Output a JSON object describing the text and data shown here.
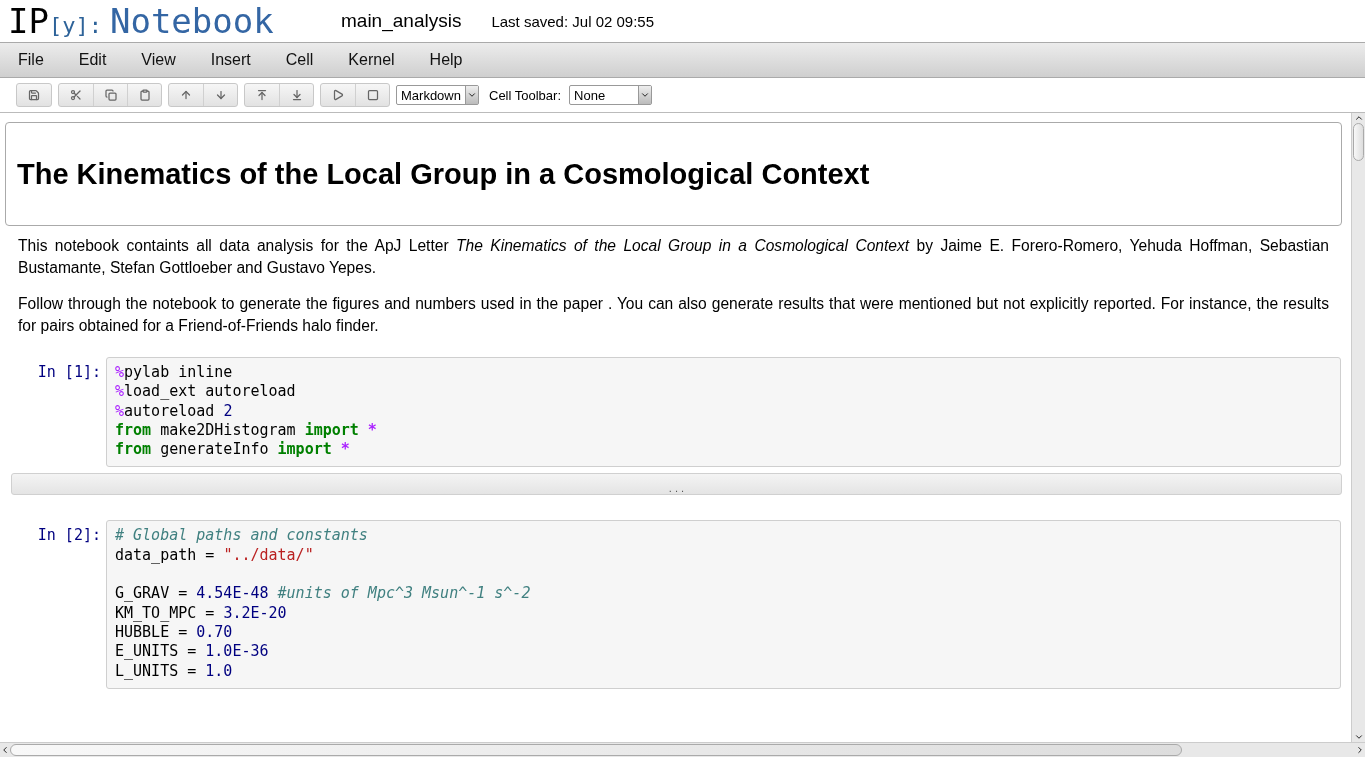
{
  "header": {
    "logo_main": "IP",
    "logo_bracket": "[y]:",
    "logo_word": "Notebook",
    "notebook_name": "main_analysis",
    "last_saved": "Last saved: Jul 02 09:55"
  },
  "menu": [
    "File",
    "Edit",
    "View",
    "Insert",
    "Cell",
    "Kernel",
    "Help"
  ],
  "toolbar": {
    "cell_type": "Markdown",
    "cell_toolbar_label": "Cell Toolbar:",
    "cell_toolbar_value": "None"
  },
  "cells": [
    {
      "kind": "heading",
      "selected": true,
      "text": "The Kinematics of the Local Group in a Cosmological Context"
    },
    {
      "kind": "markdown",
      "selected": false,
      "paragraphs": [
        "This notebook containts all data analysis for the ApJ Letter *The Kinematics of the Local Group in a Cosmological Context* by Jaime E. Forero-Romero, Yehuda Hoffman, Sebastian Bustamante, Stefan Gottloeber and Gustavo Yepes.",
        "Follow through the notebook to generate the figures and numbers used in the paper . You can also generate results that were mentioned but not explicitly reported. For instance, the results for pairs obtained for a Friend-of-Friends halo finder."
      ]
    },
    {
      "kind": "code",
      "selected": false,
      "prompt": "In [1]:",
      "lines": [
        {
          "tokens": [
            {
              "kind": "magic",
              "text": "%"
            },
            {
              "kind": "plain",
              "text": "pylab inline"
            }
          ]
        },
        {
          "tokens": [
            {
              "kind": "magic",
              "text": "%"
            },
            {
              "kind": "plain",
              "text": "load_ext autoreload"
            }
          ]
        },
        {
          "tokens": [
            {
              "kind": "magic",
              "text": "%"
            },
            {
              "kind": "plain",
              "text": "autoreload "
            },
            {
              "kind": "number",
              "text": "2"
            }
          ]
        },
        {
          "tokens": [
            {
              "kind": "keyword",
              "text": "from"
            },
            {
              "kind": "plain",
              "text": " make2DHistogram "
            },
            {
              "kind": "keyword",
              "text": "import"
            },
            {
              "kind": "op",
              "text": " *"
            }
          ]
        },
        {
          "tokens": [
            {
              "kind": "keyword",
              "text": "from"
            },
            {
              "kind": "plain",
              "text": " generateInfo "
            },
            {
              "kind": "keyword",
              "text": "import"
            },
            {
              "kind": "op",
              "text": " *"
            }
          ]
        }
      ]
    },
    {
      "kind": "collapsed",
      "selected": false,
      "text": ". . ."
    },
    {
      "kind": "code",
      "selected": false,
      "prompt": "In [2]:",
      "lines": [
        {
          "tokens": [
            {
              "kind": "comment",
              "text": "# Global paths and constants"
            }
          ]
        },
        {
          "tokens": [
            {
              "kind": "plain",
              "text": "data_path = "
            },
            {
              "kind": "string",
              "text": "\"../data/\""
            }
          ]
        },
        {
          "blank_before": true,
          "tokens": [
            {
              "kind": "plain",
              "text": "G_GRAV = "
            },
            {
              "kind": "number",
              "text": "4.54E-48"
            },
            {
              "kind": "comment",
              "text": " #units of Mpc^3 Msun^-1 s^-2"
            }
          ]
        },
        {
          "tokens": [
            {
              "kind": "plain",
              "text": "KM_TO_MPC = "
            },
            {
              "kind": "number",
              "text": "3.2E-20"
            }
          ]
        },
        {
          "tokens": [
            {
              "kind": "plain",
              "text": "HUBBLE = "
            },
            {
              "kind": "number",
              "text": "0.70"
            }
          ]
        },
        {
          "tokens": [
            {
              "kind": "plain",
              "text": "E_UNITS = "
            },
            {
              "kind": "number",
              "text": "1.0E-36"
            }
          ]
        },
        {
          "tokens": [
            {
              "kind": "plain",
              "text": "L_UNITS = "
            },
            {
              "kind": "number",
              "text": "1.0"
            }
          ]
        }
      ]
    }
  ]
}
